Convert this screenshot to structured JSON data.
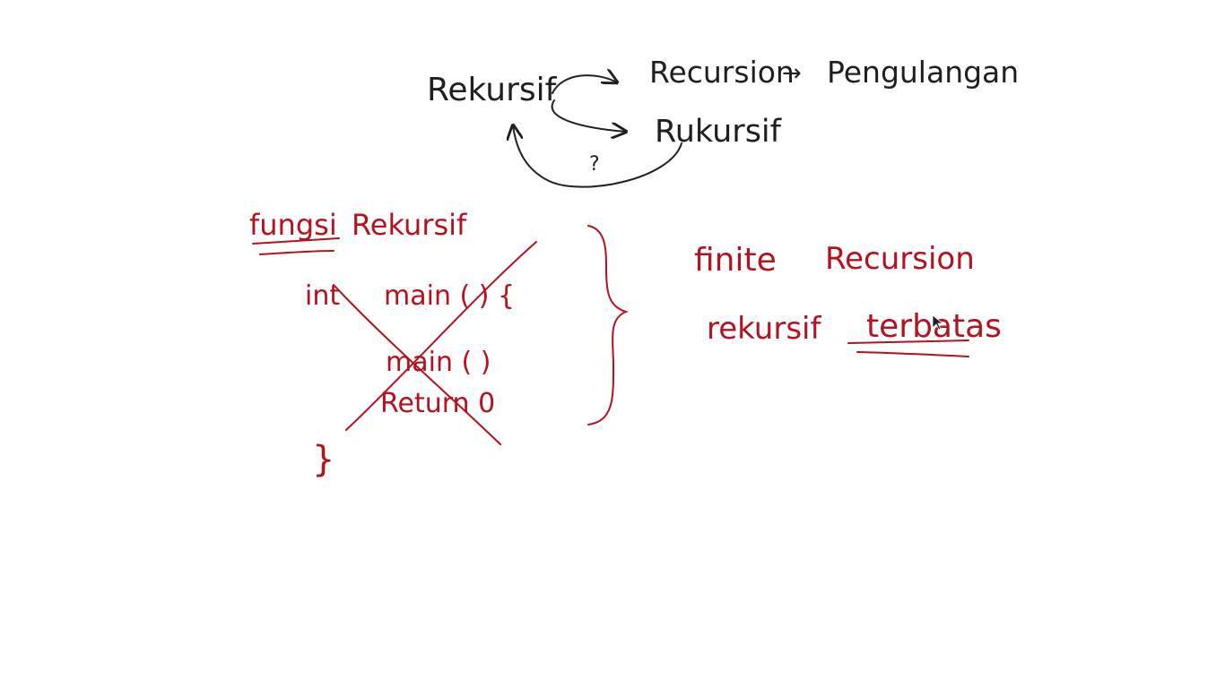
{
  "colors": {
    "ink_black": "#1f1f1f",
    "ink_red": "#b3121f",
    "background": "#ffffff"
  },
  "top": {
    "rekursif": "Rekursif",
    "recursion": "Recursion",
    "arrow": "→",
    "pengulangan": "Pengulangan",
    "rukursif": "Rukursif",
    "question": "?"
  },
  "left": {
    "heading_word1": "fungsi",
    "heading_word2": "Rekursif",
    "code": {
      "line1_type": "int",
      "line1_rest": "main ( ) {",
      "line2": "main ( )",
      "line3": "Return  0",
      "close": "}"
    }
  },
  "right": {
    "line1_word1": "finite",
    "line1_word2": "Recursion",
    "line2_word1": "rekursif",
    "line2_word2": "terbatas"
  }
}
